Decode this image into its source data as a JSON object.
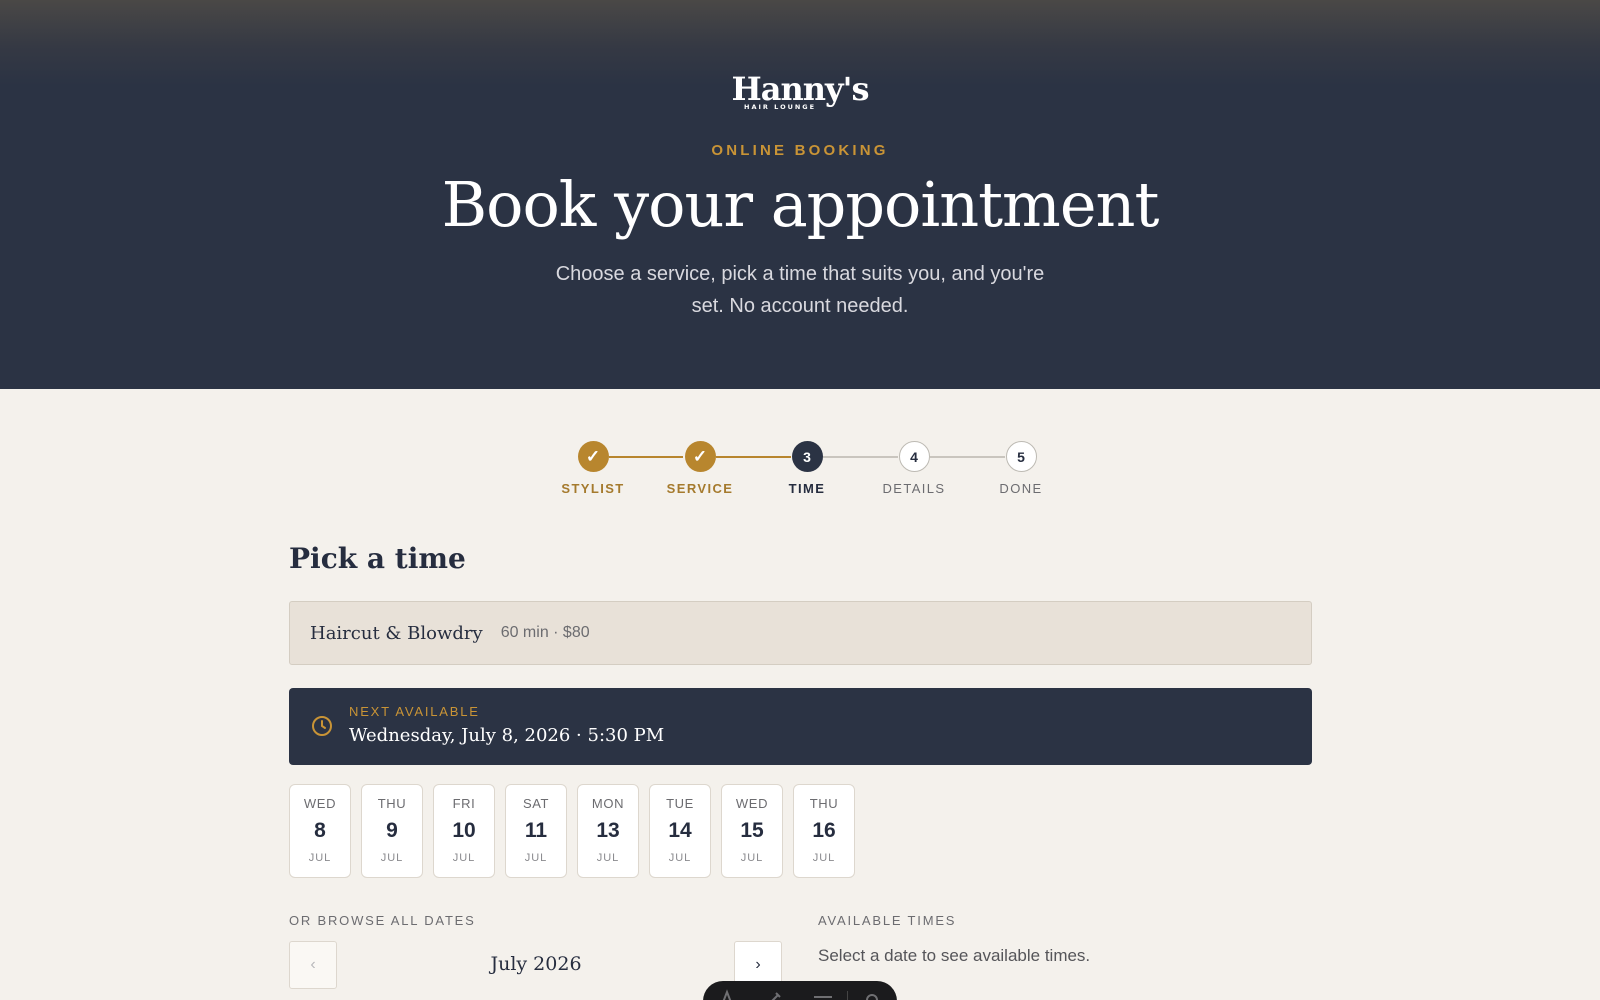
{
  "brand": {
    "name": "Hanny's",
    "tagline": "HAIR LOUNGE"
  },
  "hero": {
    "eyebrow": "ONLINE BOOKING",
    "title": "Book your appointment",
    "subtitle": "Choose a service, pick a time that suits you, and you're set. No account needed."
  },
  "stepper": {
    "steps": [
      {
        "label": "STYLIST",
        "marker": "✓",
        "state": "done"
      },
      {
        "label": "SERVICE",
        "marker": "✓",
        "state": "done"
      },
      {
        "label": "TIME",
        "marker": "3",
        "state": "active"
      },
      {
        "label": "DETAILS",
        "marker": "4",
        "state": "todo"
      },
      {
        "label": "DONE",
        "marker": "5",
        "state": "todo"
      }
    ]
  },
  "main": {
    "title": "Pick a time",
    "service": {
      "name": "Haircut & Blowdry",
      "meta": "60 min · $80"
    },
    "next_available": {
      "label": "NEXT AVAILABLE",
      "value": "Wednesday, July 8, 2026 · 5:30 PM",
      "icon": "clock-icon"
    },
    "dates": [
      {
        "dow": "WED",
        "day": "8",
        "month": "JUL"
      },
      {
        "dow": "THU",
        "day": "9",
        "month": "JUL"
      },
      {
        "dow": "FRI",
        "day": "10",
        "month": "JUL"
      },
      {
        "dow": "SAT",
        "day": "11",
        "month": "JUL"
      },
      {
        "dow": "MON",
        "day": "13",
        "month": "JUL"
      },
      {
        "dow": "TUE",
        "day": "14",
        "month": "JUL"
      },
      {
        "dow": "WED",
        "day": "15",
        "month": "JUL"
      },
      {
        "dow": "THU",
        "day": "16",
        "month": "JUL"
      }
    ],
    "browse_label": "OR BROWSE ALL DATES",
    "calendar": {
      "month": "July 2026",
      "prev": "‹",
      "next": "›"
    },
    "available_times": {
      "label": "AVAILABLE TIMES",
      "empty_text": "Select a date to see available times."
    }
  },
  "colors": {
    "navy": "#2b3344",
    "gold": "#b8862e",
    "cream": "#f4f1ec"
  }
}
